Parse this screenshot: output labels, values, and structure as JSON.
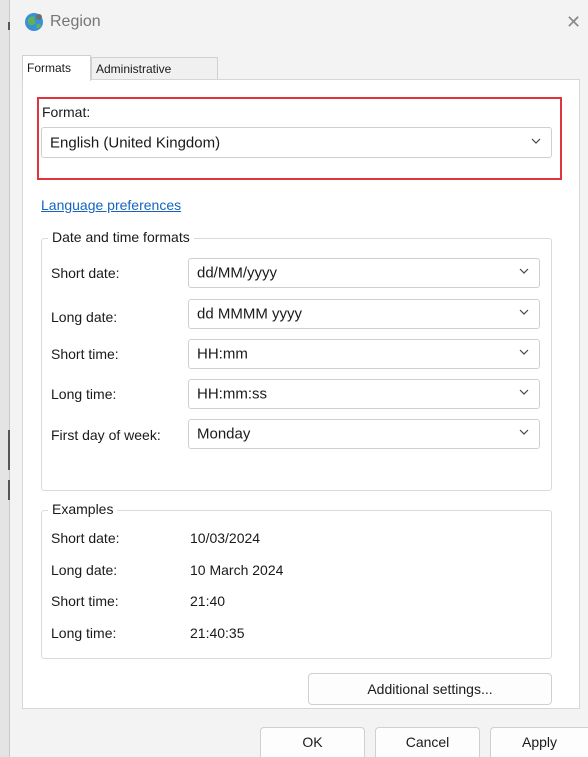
{
  "window": {
    "title": "Region",
    "close_glyph": "✕",
    "app_icon": "globe-icon"
  },
  "tabs": [
    {
      "label": "Formats",
      "active": true
    },
    {
      "label": "Administrative",
      "active": false
    }
  ],
  "format": {
    "label": "Format:",
    "value": "English (United Kingdom)",
    "highlight_color": "#e0353c"
  },
  "language_link": "Language preferences",
  "date_time": {
    "title": "Date and time formats",
    "rows": [
      {
        "label": "Short date:",
        "value": "dd/MM/yyyy"
      },
      {
        "label": "Long date:",
        "value": "dd MMMM yyyy"
      },
      {
        "label": "Short time:",
        "value": "HH:mm"
      },
      {
        "label": "Long time:",
        "value": "HH:mm:ss"
      },
      {
        "label": "First day of week:",
        "value": "Monday"
      }
    ]
  },
  "examples": {
    "title": "Examples",
    "rows": [
      {
        "label": "Short date:",
        "value": "10/03/2024"
      },
      {
        "label": "Long date:",
        "value": "10 March 2024"
      },
      {
        "label": "Short time:",
        "value": "21:40"
      },
      {
        "label": "Long time:",
        "value": "21:40:35"
      }
    ]
  },
  "buttons": {
    "additional": "Additional settings...",
    "ok": "OK",
    "cancel": "Cancel",
    "apply": "Apply"
  }
}
